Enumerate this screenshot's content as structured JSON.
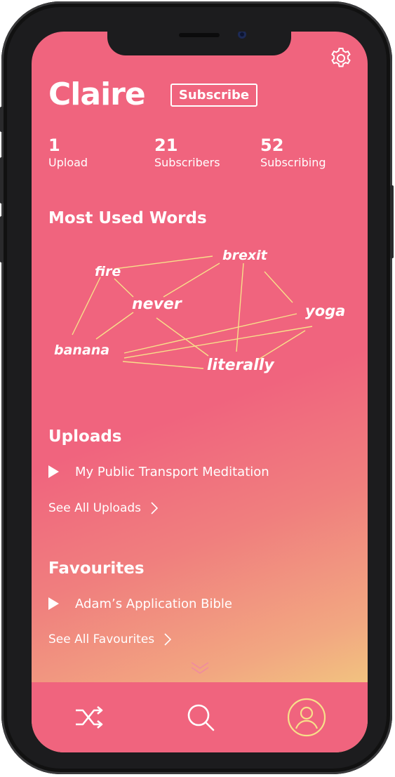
{
  "profile": {
    "name": "Claire",
    "subscribe_label": "Subscribe"
  },
  "stats": [
    {
      "value": "1",
      "label": "Upload"
    },
    {
      "value": "21",
      "label": "Subscribers"
    },
    {
      "value": "52",
      "label": "Subscribing"
    }
  ],
  "most_used_words": {
    "title": "Most Used Words",
    "words": [
      "fire",
      "brexit",
      "never",
      "yoga",
      "banana",
      "literally"
    ]
  },
  "uploads": {
    "title": "Uploads",
    "items": [
      "My Public Transport Meditation"
    ],
    "see_all_label": "See All Uploads"
  },
  "favourites": {
    "title": "Favourites",
    "items": [
      "Adam’s Application Bible"
    ],
    "see_all_label": "See All Favourites"
  },
  "tabs": [
    {
      "icon": "shuffle-icon"
    },
    {
      "icon": "search-icon"
    },
    {
      "icon": "profile-icon",
      "active": true
    }
  ],
  "colors": {
    "primary": "#f0647e",
    "gradient_end": "#f1e07f",
    "accent_line": "#f7e08a",
    "active_tab": "#f7e08a"
  }
}
